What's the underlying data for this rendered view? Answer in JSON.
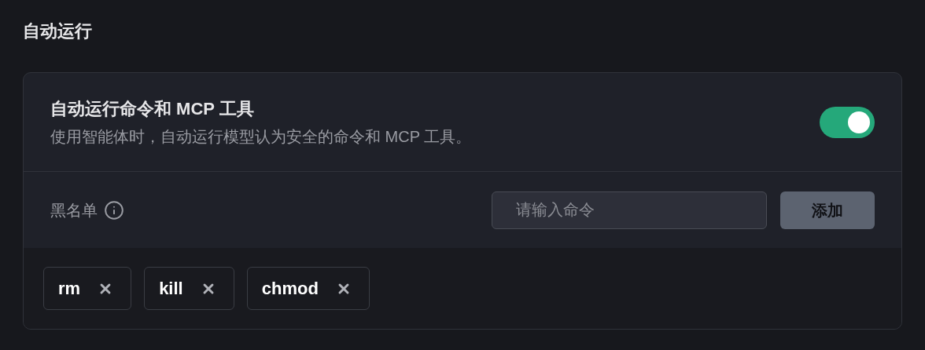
{
  "section_title": "自动运行",
  "setting": {
    "title": "自动运行命令和 MCP 工具",
    "description": "使用智能体时，自动运行模型认为安全的命令和 MCP 工具。",
    "on": true
  },
  "blacklist": {
    "label": "黑名单",
    "input": {
      "placeholder": "请输入命令"
    },
    "add_button": "添加",
    "tags": [
      {
        "label": "rm"
      },
      {
        "label": "kill"
      },
      {
        "label": "chmod"
      }
    ]
  }
}
